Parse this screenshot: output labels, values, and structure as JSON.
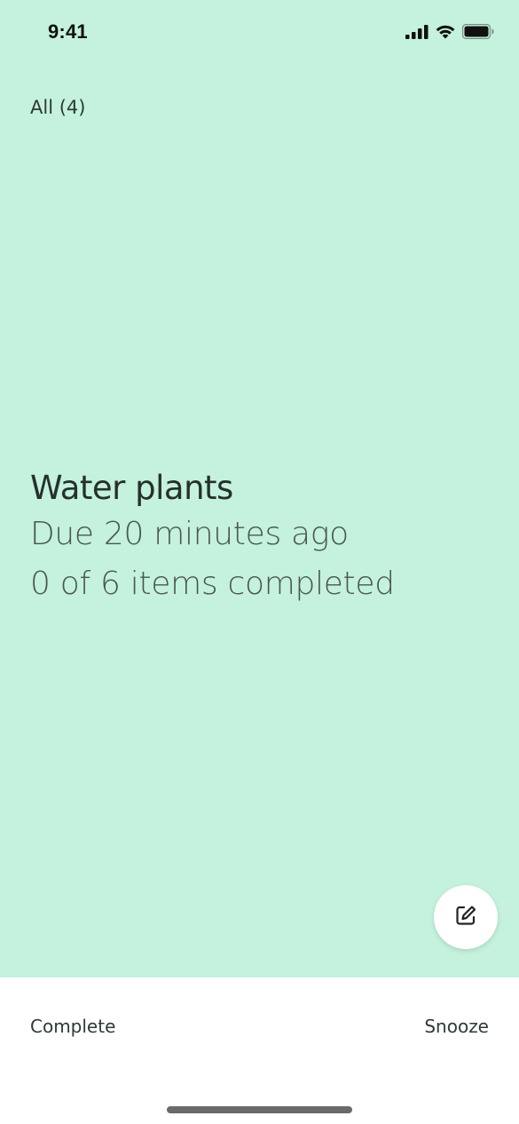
{
  "status_bar": {
    "time": "9:41",
    "icons": [
      "cellular-signal-icon",
      "wifi-icon",
      "battery-icon"
    ]
  },
  "filter": {
    "label": "All (4)"
  },
  "task": {
    "title": "Water plants",
    "due": "Due 20 minutes ago",
    "progress": "0 of 6 items completed",
    "items_completed": 0,
    "items_total": 6
  },
  "fab": {
    "icon": "edit-icon"
  },
  "actions": {
    "complete_label": "Complete",
    "snooze_label": "Snooze"
  },
  "colors": {
    "background": "#c4f2dc",
    "bottom_bar": "#ffffff",
    "text": "#2f3a36"
  }
}
